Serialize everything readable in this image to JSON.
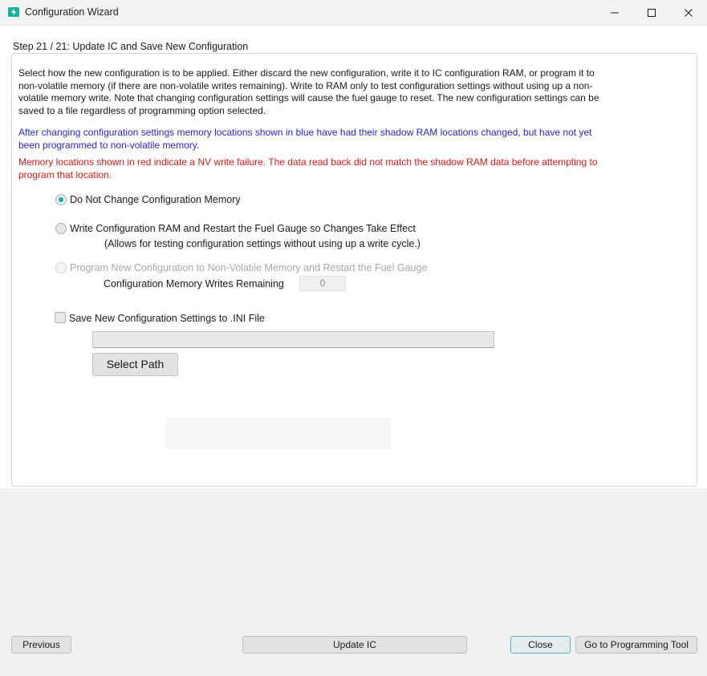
{
  "window": {
    "title": "Configuration Wizard"
  },
  "step": {
    "title": "Step 21 / 21: Update IC and Save New Configuration"
  },
  "description": {
    "main": "Select how the new configuration is to be applied. Either discard the new configuration, write it to IC configuration RAM, or program it to non-volatile memory (if there are non-volatile writes remaining). Write to RAM only to test configuration settings without using up a non-volatile memory write. Note that changing configuration settings will cause the fuel gauge to reset. The new configuration settings can be saved to a file regardless of programming option selected.",
    "blue_note": "After changing configuration settings memory locations shown in blue have had their shadow RAM locations changed, but have not yet been programmed to non-volatile memory.",
    "red_note": "Memory locations shown in red indicate a NV write failure. The data read back did not match the shadow RAM data before attempting to program that location."
  },
  "options": {
    "no_change": "Do Not Change Configuration Memory",
    "write_ram": "Write Configuration RAM and Restart the Fuel Gauge so Changes Take Effect",
    "write_ram_note": "(Allows for testing configuration settings without using up a write cycle.)",
    "program_nvm": "Program New Configuration to Non-Volatile Memory and Restart the Fuel Gauge",
    "writes_remaining_label": "Configuration Memory Writes Remaining",
    "writes_remaining_value": "0"
  },
  "save": {
    "checkbox_label": "Save New Configuration Settings to .INI File",
    "path_value": "",
    "select_path_label": "Select Path"
  },
  "footer": {
    "previous": "Previous",
    "update_ic": "Update IC",
    "close": "Close",
    "goto_programming": "Go to Programming Tool"
  },
  "colors": {
    "accent": "#1fa7a5",
    "blue_text": "#2727c9",
    "red_text": "#d01919"
  }
}
